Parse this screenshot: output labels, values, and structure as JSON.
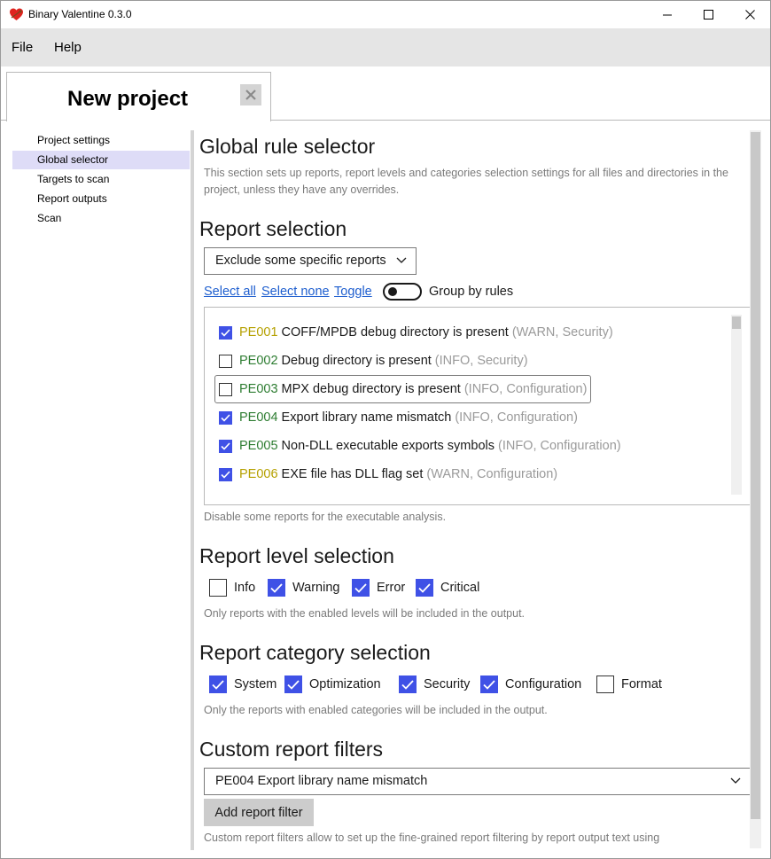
{
  "window": {
    "title": "Binary Valentine 0.3.0"
  },
  "menu": {
    "file": "File",
    "help": "Help"
  },
  "tab": {
    "title": "New project"
  },
  "sidebar": {
    "items": [
      {
        "label": "Project settings",
        "active": false
      },
      {
        "label": "Global selector",
        "active": true
      },
      {
        "label": "Targets to scan",
        "active": false
      },
      {
        "label": "Report outputs",
        "active": false
      },
      {
        "label": "Scan",
        "active": false
      }
    ]
  },
  "main": {
    "heading": "Global rule selector",
    "description": "This section sets up reports, report levels and categories selection settings for all files and directories in the project, unless they have any overrides.",
    "report_selection": {
      "heading": "Report selection",
      "mode": "Exclude some specific reports",
      "select_all": "Select all",
      "select_none": "Select none",
      "toggle": "Toggle",
      "group_label": "Group by rules",
      "group_enabled": false,
      "reports": [
        {
          "code": "PE001",
          "name": "COFF/MPDB debug directory is present",
          "meta": "(WARN, Security)",
          "checked": true,
          "code_color": "#b5a000"
        },
        {
          "code": "PE002",
          "name": "Debug directory is present",
          "meta": "(INFO, Security)",
          "checked": false,
          "code_color": "#2e7d32"
        },
        {
          "code": "PE003",
          "name": "MPX debug directory is present",
          "meta": "(INFO, Configuration)",
          "checked": false,
          "code_color": "#2e7d32"
        },
        {
          "code": "PE004",
          "name": "Export library name mismatch",
          "meta": "(INFO, Configuration)",
          "checked": true,
          "code_color": "#2e7d32"
        },
        {
          "code": "PE005",
          "name": "Non-DLL executable exports symbols",
          "meta": "(INFO, Configuration)",
          "checked": true,
          "code_color": "#2e7d32"
        },
        {
          "code": "PE006",
          "name": "EXE file has DLL flag set",
          "meta": "(WARN, Configuration)",
          "checked": true,
          "code_color": "#b5a000"
        }
      ],
      "hint": "Disable some reports for the executable analysis."
    },
    "level_selection": {
      "heading": "Report level selection",
      "levels": [
        {
          "label": "Info",
          "checked": false
        },
        {
          "label": "Warning",
          "checked": true
        },
        {
          "label": "Error",
          "checked": true
        },
        {
          "label": "Critical",
          "checked": true
        }
      ],
      "hint": "Only reports with the enabled levels will be included in the output."
    },
    "category_selection": {
      "heading": "Report category selection",
      "categories": [
        {
          "label": "System",
          "checked": true
        },
        {
          "label": "Optimization",
          "checked": true
        },
        {
          "label": "Security",
          "checked": true
        },
        {
          "label": "Configuration",
          "checked": true
        },
        {
          "label": "Format",
          "checked": false
        }
      ],
      "hint": "Only the reports with enabled categories will be included in the output."
    },
    "custom_filters": {
      "heading": "Custom report filters",
      "selected": "PE004 Export library name mismatch",
      "add_button": "Add report filter",
      "hint": "Custom report filters allow to set up the fine-grained report filtering by report output text using"
    }
  },
  "colors": {
    "accent": "#3f51e6",
    "link": "#1f5fcf",
    "sidebar_active": "#dedcf7",
    "muted_text": "#9a9a9a"
  }
}
